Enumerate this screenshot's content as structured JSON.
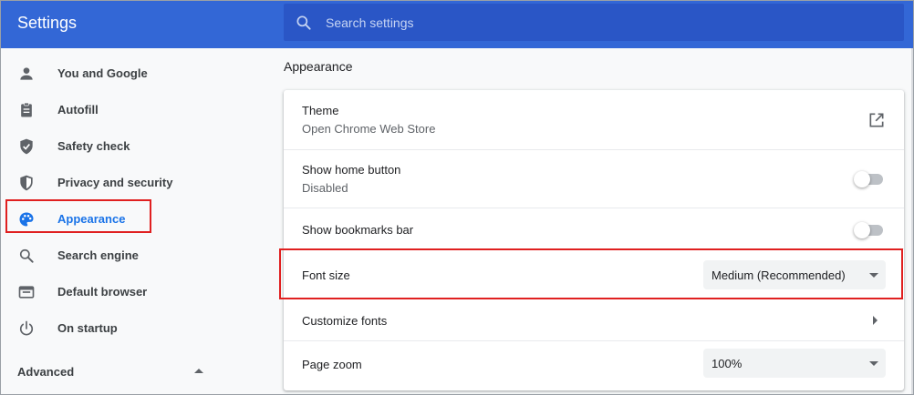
{
  "header": {
    "title": "Settings",
    "search_placeholder": "Search settings",
    "colors": {
      "bar": "#3367d6",
      "search_bg": "#2a56c6"
    }
  },
  "sidebar": {
    "items": [
      {
        "label": "You and Google",
        "icon": "person-icon",
        "active": false
      },
      {
        "label": "Autofill",
        "icon": "clipboard-icon",
        "active": false
      },
      {
        "label": "Safety check",
        "icon": "shield-check-icon",
        "active": false
      },
      {
        "label": "Privacy and security",
        "icon": "shield-icon",
        "active": false
      },
      {
        "label": "Appearance",
        "icon": "palette-icon",
        "active": true
      },
      {
        "label": "Search engine",
        "icon": "search-icon",
        "active": false
      },
      {
        "label": "Default browser",
        "icon": "browser-icon",
        "active": false
      },
      {
        "label": "On startup",
        "icon": "power-icon",
        "active": false
      }
    ],
    "advanced_label": "Advanced",
    "active_color": "#1a73e8"
  },
  "main": {
    "section_title": "Appearance",
    "theme": {
      "label": "Theme",
      "sub": "Open Chrome Web Store"
    },
    "home_button": {
      "label": "Show home button",
      "sub": "Disabled",
      "enabled": false
    },
    "bookmarks_bar": {
      "label": "Show bookmarks bar",
      "enabled": false
    },
    "font_size": {
      "label": "Font size",
      "value": "Medium (Recommended)"
    },
    "customize_fonts": {
      "label": "Customize fonts"
    },
    "page_zoom": {
      "label": "Page zoom",
      "value": "100%"
    }
  },
  "annotations": {
    "highlight_color": "#e02020"
  }
}
